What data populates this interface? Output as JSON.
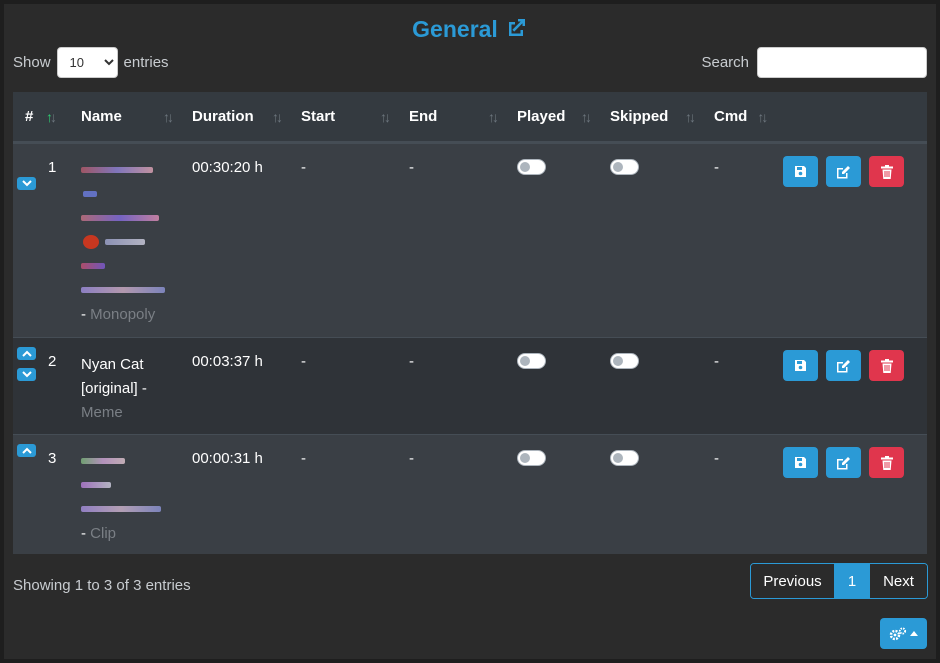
{
  "header": {
    "title": "General",
    "title_icon": "external-link-icon"
  },
  "length_menu": {
    "prefix": "Show",
    "value": "10",
    "suffix": "entries"
  },
  "search": {
    "label": "Search",
    "value": ""
  },
  "columns": [
    {
      "label": "#"
    },
    {
      "label": "Name"
    },
    {
      "label": "Duration"
    },
    {
      "label": "Start"
    },
    {
      "label": "End"
    },
    {
      "label": "Played"
    },
    {
      "label": "Skipped"
    },
    {
      "label": "Cmd"
    }
  ],
  "rows": [
    {
      "num": "1",
      "name_suffix": "- ",
      "category": "Monopoly",
      "duration": "00:30:20 h",
      "start": "-",
      "end": "-",
      "played": false,
      "skipped": false,
      "cmd": "-",
      "move_up": false,
      "move_down": true
    },
    {
      "num": "2",
      "name_line1": "Nyan Cat",
      "name_line2": "[original] -",
      "category": "Meme",
      "duration": "00:03:37 h",
      "start": "-",
      "end": "-",
      "played": false,
      "skipped": false,
      "cmd": "-",
      "move_up": true,
      "move_down": true
    },
    {
      "num": "3",
      "name_suffix": "- ",
      "category": "Clip",
      "duration": "00:00:31 h",
      "start": "-",
      "end": "-",
      "played": false,
      "skipped": false,
      "cmd": "-",
      "move_up": true,
      "move_down": false
    }
  ],
  "footer": {
    "info": "Showing 1 to 3 of 3 entries",
    "previous": "Previous",
    "page": "1",
    "next": "Next"
  },
  "colors": {
    "accent": "#2b9ad6",
    "danger": "#e0364d",
    "sort_active": "#2ecc71"
  }
}
